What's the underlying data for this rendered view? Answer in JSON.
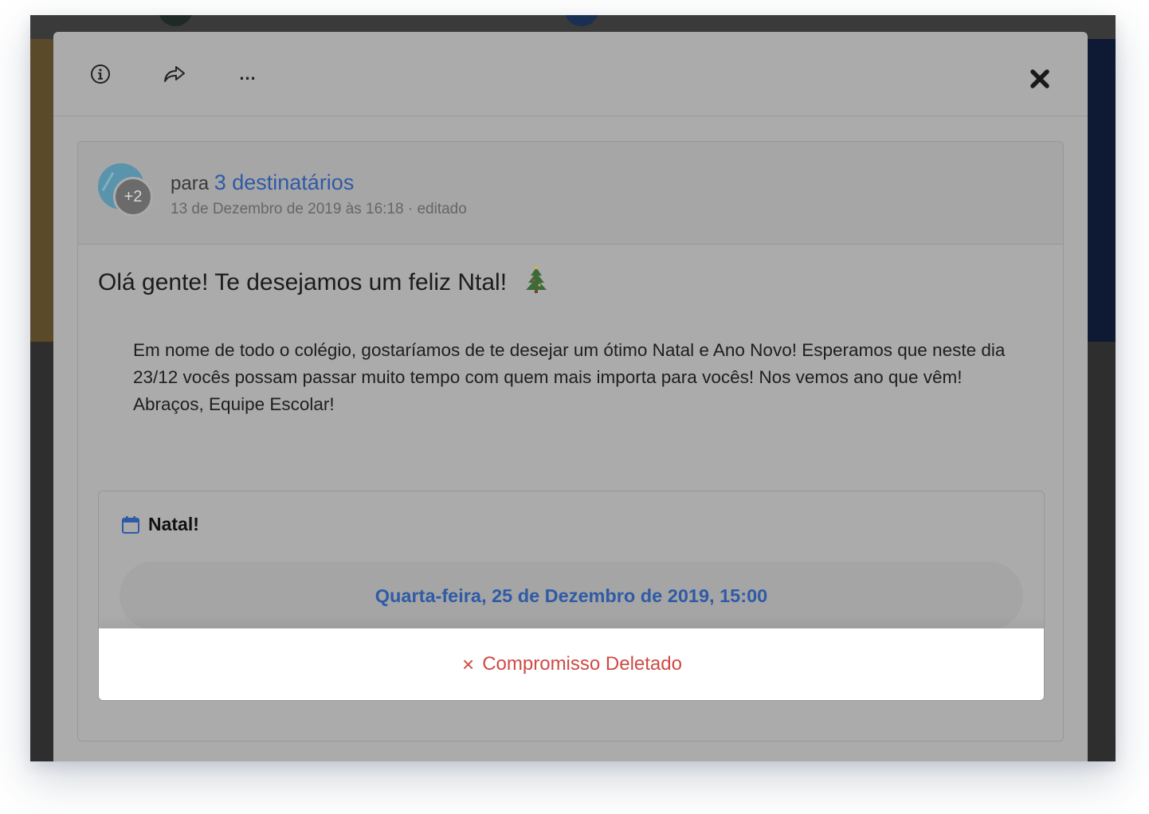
{
  "toolbar": {
    "info_icon": "info-icon",
    "share_icon": "share-icon",
    "more_label": "...",
    "close_icon": "close-icon"
  },
  "post": {
    "avatar_extra": "+2",
    "recipients_prefix": "para",
    "recipients_link": "3 destinatários",
    "meta": "13 de Dezembro de 2019 às 16:18 · editado",
    "title": "Olá gente! Te desejamos um feliz Ntal!",
    "body": "Em nome de todo o colégio, gostaríamos de te desejar um ótimo Natal e Ano Novo! Esperamos que neste dia 23/12 vocês possam passar muito tempo com quem mais importa para vocês! Nos vemos ano que vêm! Abraços, Equipe Escolar!",
    "event": {
      "icon": "calendar-icon",
      "title": "Natal!",
      "date": "Quarta-feira, 25 de Dezembro de 2019, 15:00",
      "status": "Compromisso Deletado",
      "status_icon": "×"
    }
  },
  "colors": {
    "link": "#2f5aa6",
    "deleted": "#cf4a43",
    "overlay": "#ababab"
  }
}
